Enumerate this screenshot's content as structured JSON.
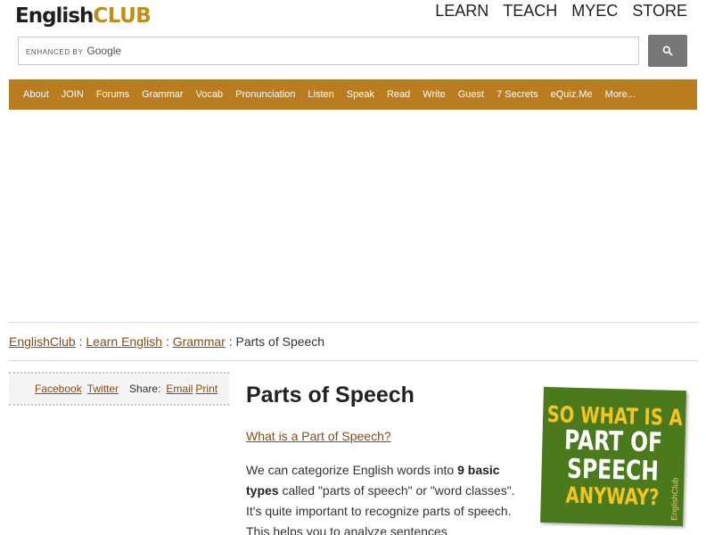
{
  "header": {
    "logo_english": "English",
    "logo_club": "CLUB",
    "topnav": [
      "LEARN",
      "TEACH",
      "MYEC",
      "STORE"
    ]
  },
  "search": {
    "enhanced_by": "ENHANCED BY",
    "brand": "Google",
    "placeholder": "",
    "button_icon": "search-icon"
  },
  "nav": {
    "items": [
      "About",
      "JOIN",
      "Forums",
      "Grammar",
      "Vocab",
      "Pronunciation",
      "Listen",
      "Speak",
      "Read",
      "Write",
      "Guest",
      "7 Secrets",
      "eQuiz.Me",
      "More..."
    ]
  },
  "breadcrumb": {
    "items": [
      "EnglishClub",
      "Learn English",
      "Grammar"
    ],
    "current": "Parts of Speech",
    "separator": ":"
  },
  "share": {
    "facebook": "Facebook",
    "twitter": "Twitter",
    "share_label": "Share:",
    "email": "Email",
    "print": "Print"
  },
  "article": {
    "title": "Parts of Speech",
    "subheading_link": "What is a Part of Speech?",
    "intro_1": "We can categorize English words into ",
    "intro_bold_1": "9 basic",
    "intro_bold_2": "types",
    "intro_2": " called \"parts of speech\" or \"word classes\". It's quite important to recognize parts of speech. This helps you to analyze sentences"
  },
  "promo": {
    "line1": "SO WHAT IS A",
    "line2": "PART OF",
    "line3": "SPEECH",
    "line4": "ANYWAY?",
    "watermark": "EnglishClub"
  },
  "colors": {
    "nav_bg": "#b97c1e",
    "link": "#8a4b10",
    "promo_bg": "#4a7a1c",
    "promo_yellow": "#f4c51c",
    "logo_club": "#c08d1a"
  }
}
